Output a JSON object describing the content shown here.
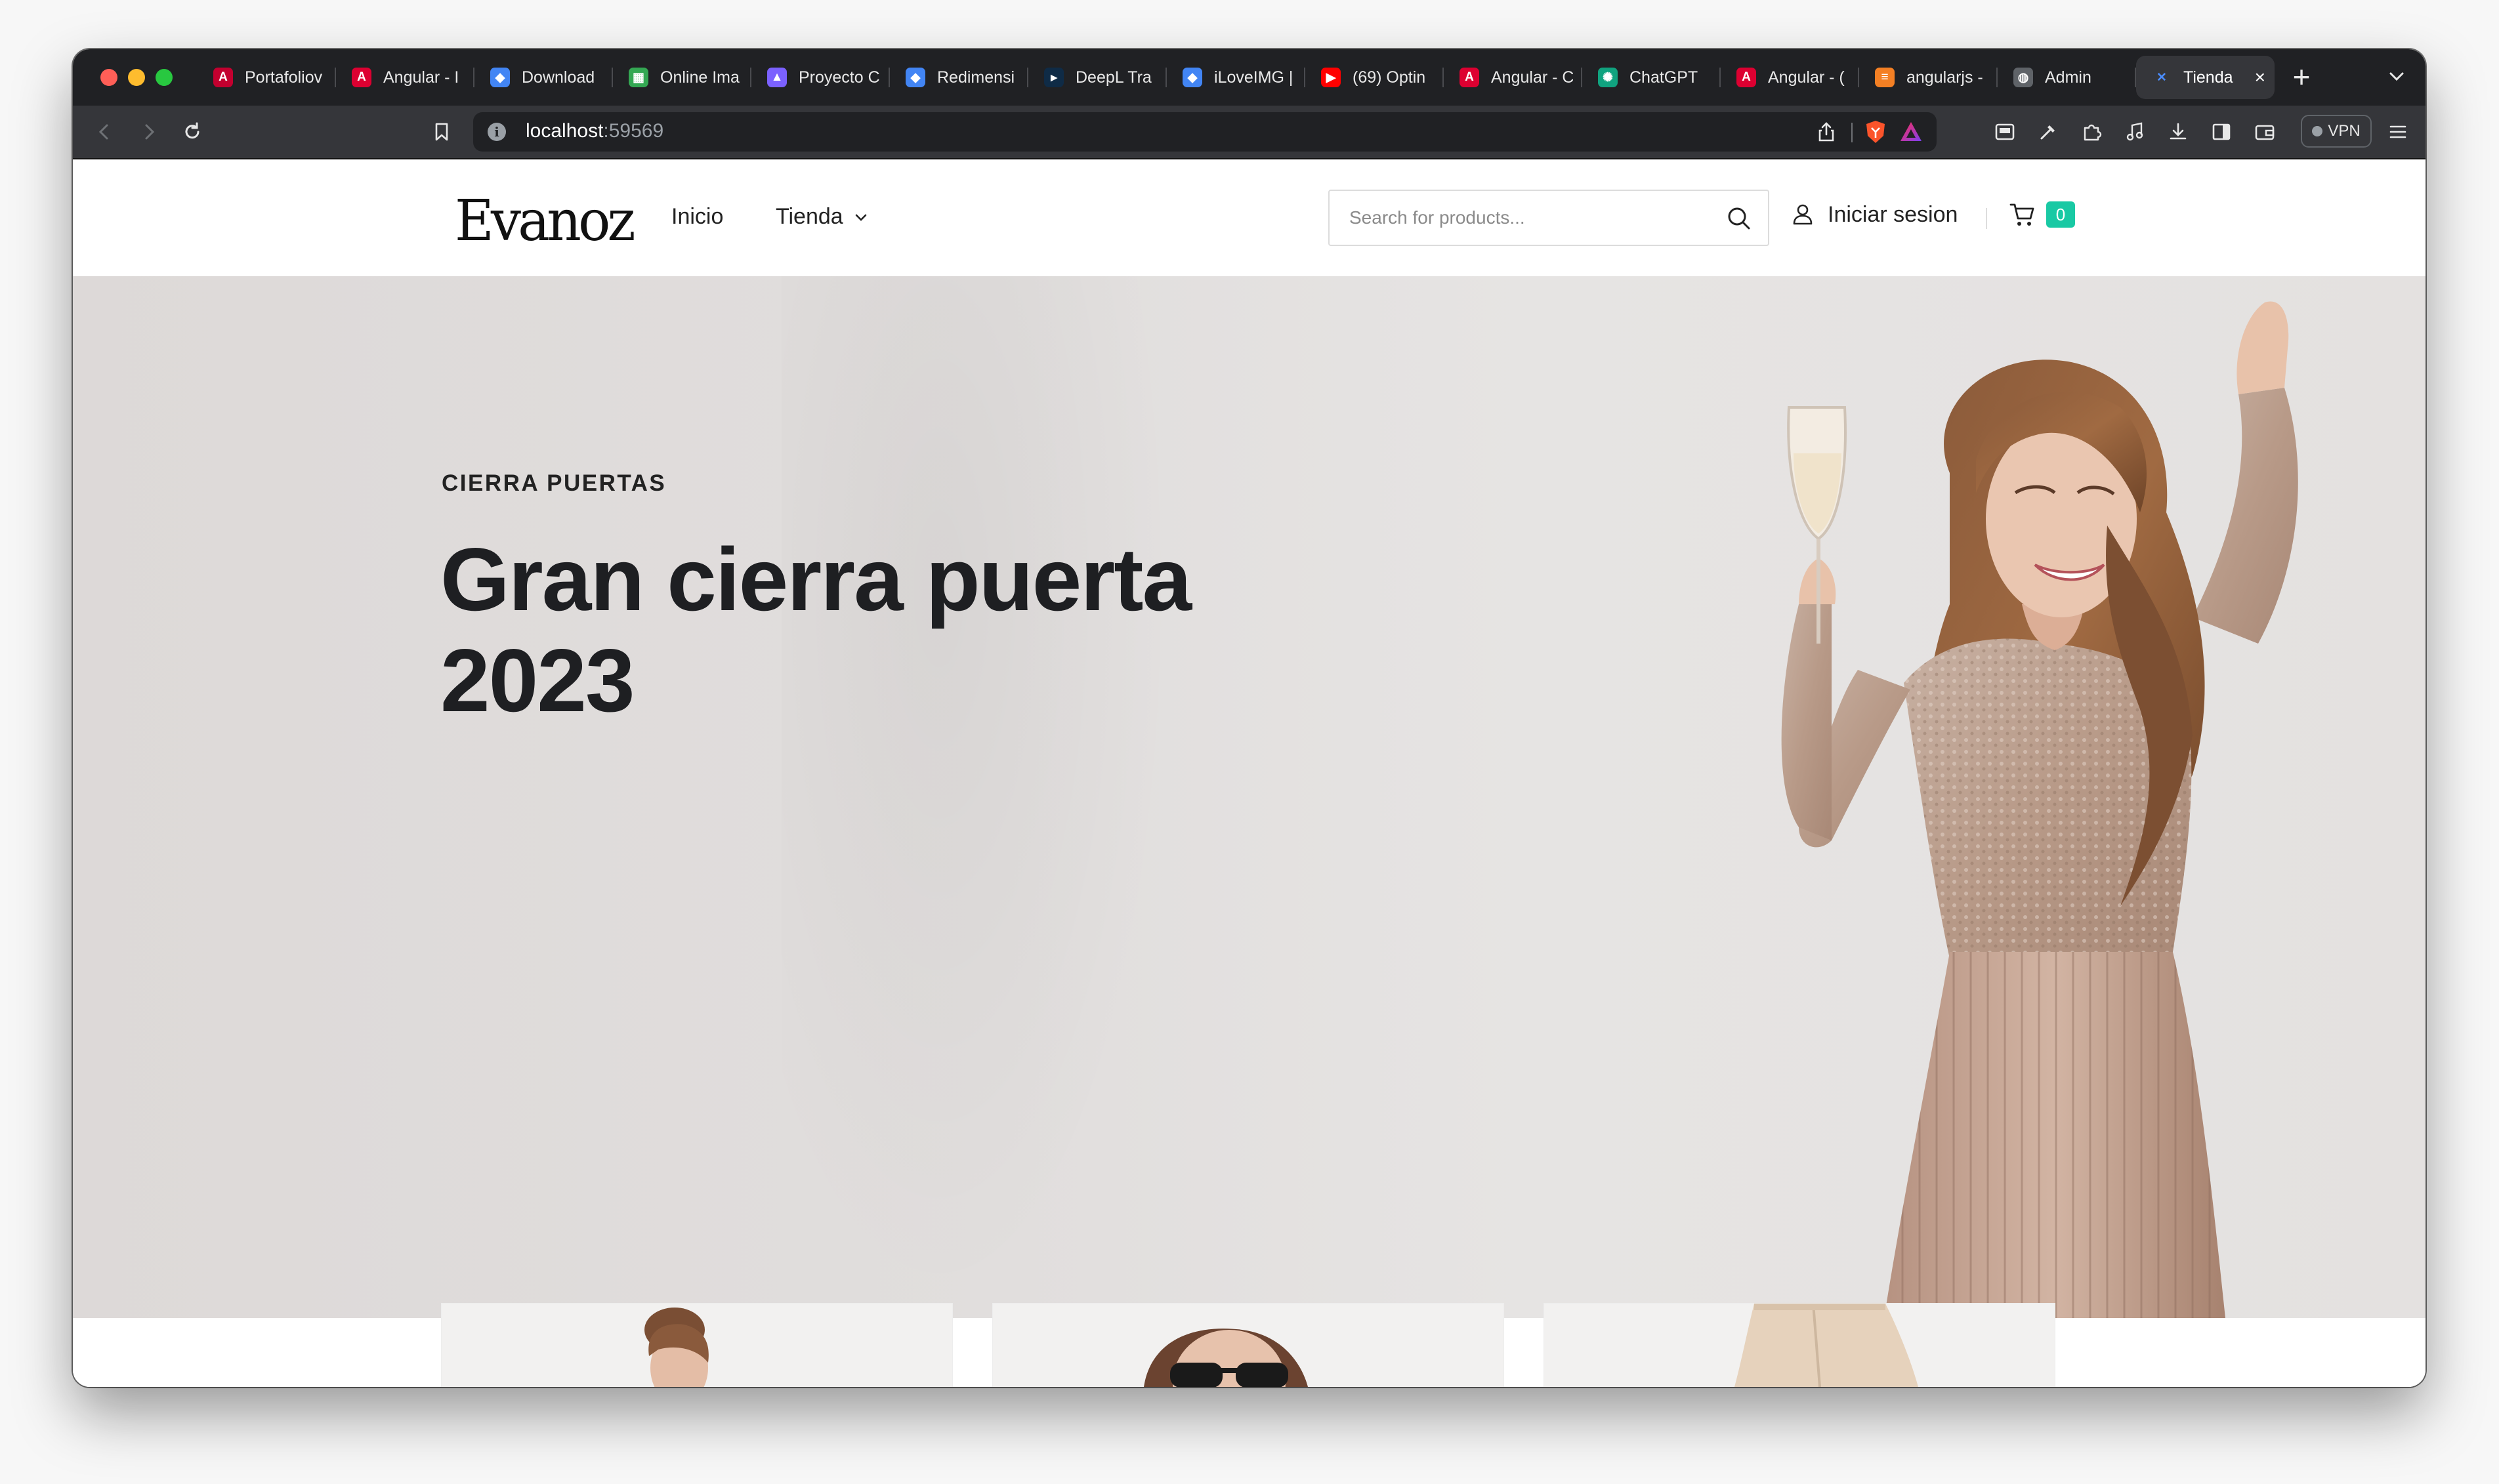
{
  "browser": {
    "tabs": [
      {
        "label": "Portafoliov",
        "icon": "angular-icon",
        "color": "#c3002f",
        "glyph": "A"
      },
      {
        "label": "Angular - I",
        "icon": "angular-icon",
        "color": "#dd0031",
        "glyph": "A"
      },
      {
        "label": "Download",
        "icon": "diamond-icon",
        "color": "#4285f4",
        "glyph": "◆"
      },
      {
        "label": "Online Ima",
        "icon": "grid-icon",
        "color": "#34a853",
        "glyph": "▦"
      },
      {
        "label": "Proyecto C",
        "icon": "triangle-icon",
        "color": "#7b61ff",
        "glyph": "▲"
      },
      {
        "label": "Redimensi",
        "icon": "diamond-icon",
        "color": "#4285f4",
        "glyph": "◆"
      },
      {
        "label": "DeepL Tra",
        "icon": "deepl-icon",
        "color": "#0f2b46",
        "glyph": "▸"
      },
      {
        "label": "iLoveIMG |",
        "icon": "diamond-icon",
        "color": "#4285f4",
        "glyph": "◆"
      },
      {
        "label": "(69) Optin",
        "icon": "youtube-icon",
        "color": "#ff0000",
        "glyph": "▶"
      },
      {
        "label": "Angular - C",
        "icon": "angular-icon",
        "color": "#dd0031",
        "glyph": "A"
      },
      {
        "label": "ChatGPT",
        "icon": "chatgpt-icon",
        "color": "#10a37f",
        "glyph": "✺"
      },
      {
        "label": "Angular - (",
        "icon": "angular-icon",
        "color": "#dd0031",
        "glyph": "A"
      },
      {
        "label": "angularjs -",
        "icon": "stackoverflow-icon",
        "color": "#f48024",
        "glyph": "≡"
      },
      {
        "label": "Admin",
        "icon": "globe-icon",
        "color": "#5f6368",
        "glyph": "◍"
      },
      {
        "label": "Tienda",
        "icon": "tienda-icon",
        "color": "#4a8cff",
        "glyph": "✕",
        "active": true
      }
    ],
    "url_host": "localhost",
    "url_port": ":59569",
    "vpn_label": "VPN"
  },
  "header": {
    "logo": "Evanoz",
    "nav": {
      "home": "Inicio",
      "shop": "Tienda"
    },
    "search": {
      "placeholder": "Search for products..."
    },
    "login_label": "Iniciar sesion",
    "cart_count": "0",
    "accent": "#19c9a4"
  },
  "hero": {
    "eyebrow": "CIERRA PUERTAS",
    "title": "Gran cierra puerta 2023"
  }
}
